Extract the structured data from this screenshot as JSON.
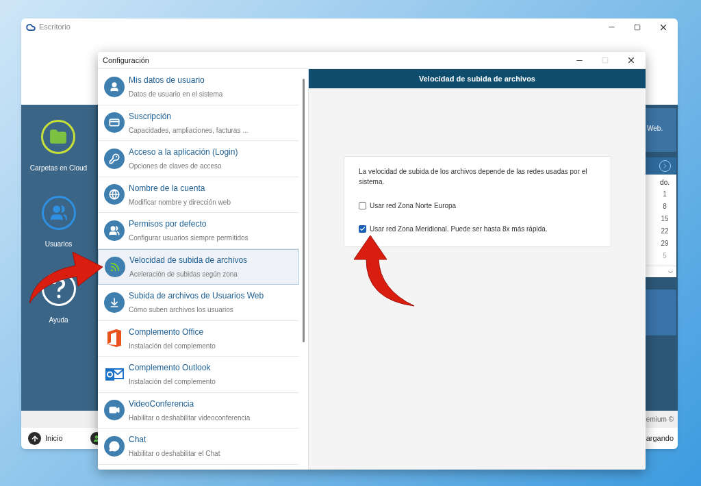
{
  "desktop_window": {
    "title": "Escritorio",
    "sidebar": [
      {
        "label": "Carpetas en Cloud",
        "kind": "folder"
      },
      {
        "label": "Usuarios",
        "kind": "users"
      },
      {
        "label": "Ayuda",
        "kind": "help"
      }
    ],
    "card_text": "Web.",
    "calendar": {
      "columns": [
        {
          "header": "do.",
          "days": [
            {
              "text": "1",
              "muted": false
            },
            {
              "text": "8",
              "muted": false
            },
            {
              "text": "15",
              "muted": false
            },
            {
              "text": "22",
              "muted": false
            },
            {
              "text": "29",
              "muted": false
            },
            {
              "text": "5",
              "muted": true
            }
          ]
        }
      ]
    },
    "footer_note": "emium ©",
    "taskbar": [
      {
        "label": "Inicio"
      }
    ],
    "status": "argando"
  },
  "dialog": {
    "title": "Configuración",
    "menu": [
      {
        "title": "Mis datos de usuario",
        "subtitle": "Datos de usuario en el sistema",
        "kind": "user",
        "selected": false
      },
      {
        "title": "Suscripción",
        "subtitle": "Capacidades, ampliaciones, facturas ...",
        "kind": "card",
        "selected": false
      },
      {
        "title": "Acceso a la aplicación (Login)",
        "subtitle": "Opciones de claves de acceso",
        "kind": "key",
        "selected": false
      },
      {
        "title": "Nombre de la cuenta",
        "subtitle": "Modificar nombre y dirección web",
        "kind": "globe",
        "selected": false
      },
      {
        "title": "Permisos por defecto",
        "subtitle": "Configurar usuarios siempre permitidos",
        "kind": "users",
        "selected": false
      },
      {
        "title": "Velocidad de subida de archivos",
        "subtitle": "Aceleración de subidas según zona",
        "kind": "feed",
        "selected": true
      },
      {
        "title": "Subida de archivos de Usuarios Web",
        "subtitle": "Cómo suben archivos los usuarios",
        "kind": "upload",
        "selected": false
      },
      {
        "title": "Complemento Office",
        "subtitle": "Instalación del complemento",
        "kind": "office",
        "selected": false
      },
      {
        "title": "Complemento Outlook",
        "subtitle": "Instalación del complemento",
        "kind": "outlook",
        "selected": false
      },
      {
        "title": "VideoConferencia",
        "subtitle": "Habilitar o deshabilitar videoconferencia",
        "kind": "video",
        "selected": false
      },
      {
        "title": "Chat",
        "subtitle": "Habilitar o deshabilitar el Chat",
        "kind": "chat",
        "selected": false
      }
    ],
    "header": "Velocidad de subida de archivos",
    "description": "La velocidad de subida de los archivos depende de las redes usadas por el sistema.",
    "options": [
      {
        "label": "Usar red Zona Norte Europa",
        "checked": false
      },
      {
        "label": "Usar red Zona Meridional. Puede ser hasta 8x más rápida.",
        "checked": true
      }
    ]
  }
}
